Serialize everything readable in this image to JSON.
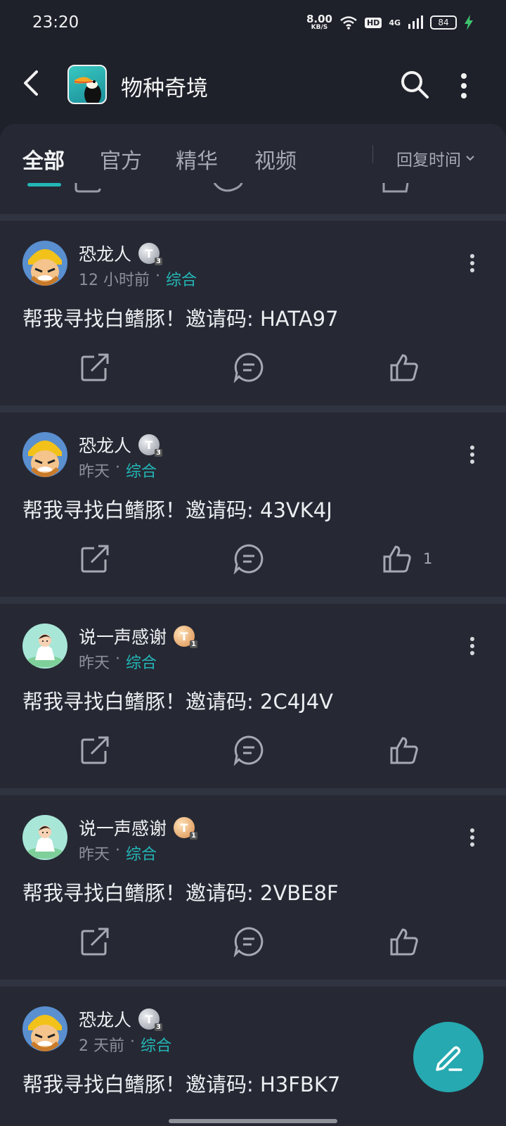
{
  "status_bar": {
    "time": "23:20",
    "net_speed": "8.00",
    "net_unit": "KB/S",
    "hd": "HD",
    "network": "4G",
    "battery": "84"
  },
  "header": {
    "title": "物种奇境"
  },
  "tabs": [
    {
      "label": "全部",
      "active": true
    },
    {
      "label": "官方",
      "active": false
    },
    {
      "label": "精华",
      "active": false
    },
    {
      "label": "视频",
      "active": false
    }
  ],
  "sort": {
    "label": "回复时间"
  },
  "posts": [
    {
      "author": "恐龙人",
      "badge": "T",
      "time": "12 小时前",
      "category": "综合",
      "content": "帮我寻找白鳍豚！邀请码: HATA97",
      "likes": ""
    },
    {
      "author": "恐龙人",
      "badge": "T",
      "time": "昨天",
      "category": "综合",
      "content": "帮我寻找白鳍豚！邀请码: 43VK4J",
      "likes": "1"
    },
    {
      "author": "说一声感谢",
      "badge": "T",
      "time": "昨天",
      "category": "综合",
      "content": "帮我寻找白鳍豚！邀请码: 2C4J4V",
      "likes": ""
    },
    {
      "author": "说一声感谢",
      "badge": "T",
      "time": "昨天",
      "category": "综合",
      "content": "帮我寻找白鳍豚！邀请码: 2VBE8F",
      "likes": ""
    },
    {
      "author": "恐龙人",
      "badge": "T",
      "time": "2 天前",
      "category": "综合",
      "content": "帮我寻找白鳍豚！邀请码: H3FBK7",
      "likes": ""
    }
  ],
  "colors": {
    "accent": "#23b6b6",
    "background": "#1e202a",
    "card": "#262934"
  }
}
